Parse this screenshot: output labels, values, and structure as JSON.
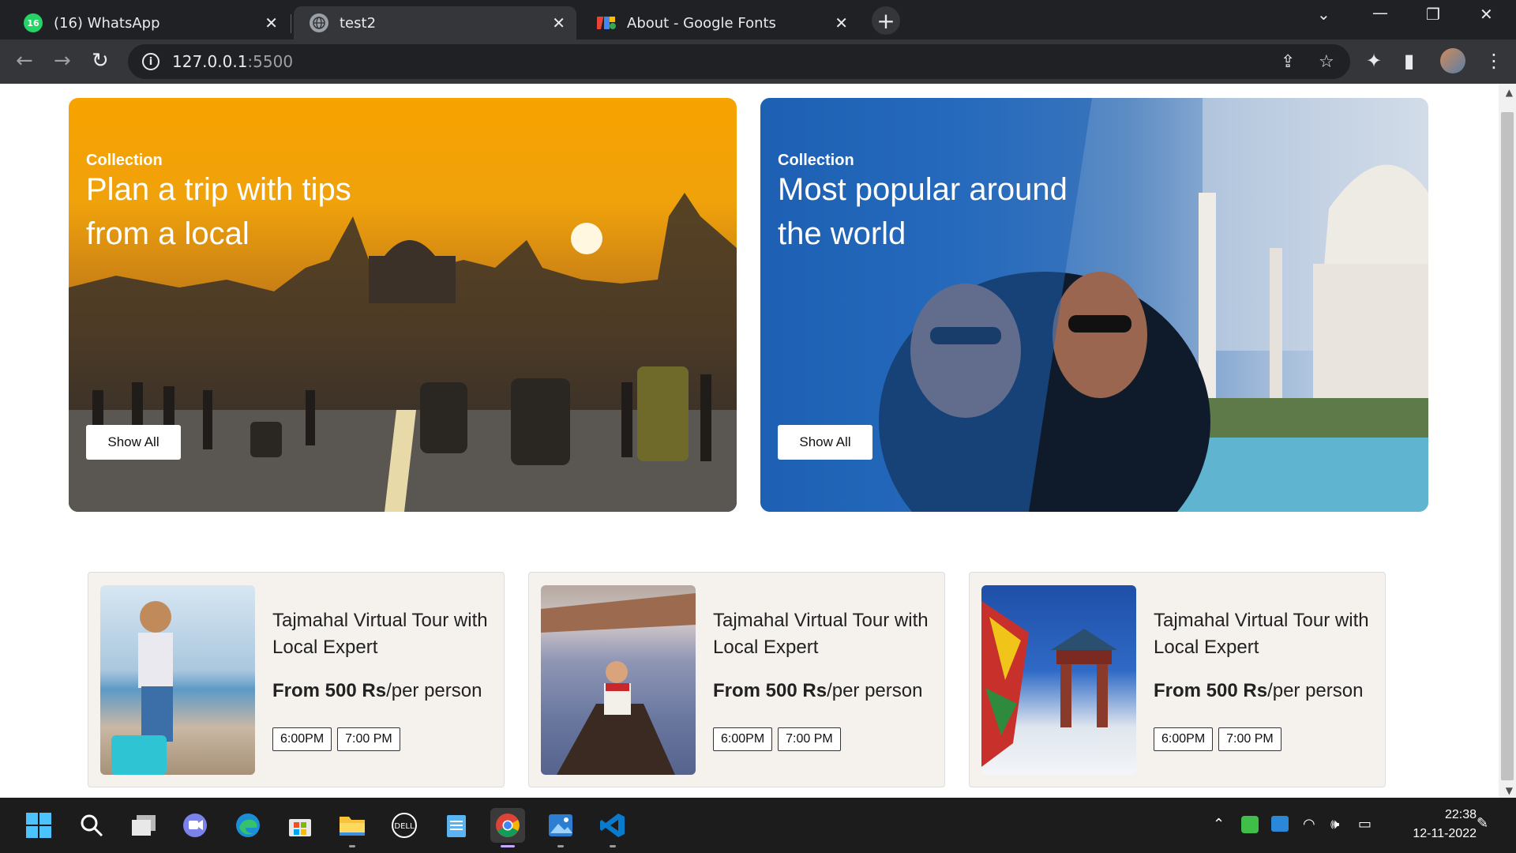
{
  "browser": {
    "tabs": [
      {
        "title": "(16) WhatsApp",
        "badge": "16",
        "favicon": "whatsapp-icon",
        "active": false
      },
      {
        "title": "test2",
        "favicon": "globe-icon",
        "active": true
      },
      {
        "title": "About - Google Fonts",
        "favicon": "google-fonts-icon",
        "active": false
      }
    ],
    "address": {
      "host": "127.0.0.1",
      "port": ":5500"
    }
  },
  "hero_cards": [
    {
      "kicker": "Collection",
      "headline": "Plan a trip with tips from a local",
      "button": "Show All"
    },
    {
      "kicker": "Collection",
      "headline": "Most popular around the world",
      "button": "Show All"
    }
  ],
  "tours": [
    {
      "title": "Tajmahal Virtual Tour with Local Expert",
      "price_bold": "From 500 Rs",
      "price_unit": "/per person",
      "slots": [
        "6:00PM",
        "7:00 PM"
      ]
    },
    {
      "title": "Tajmahal Virtual Tour with Local Expert",
      "price_bold": "From 500 Rs",
      "price_unit": "/per person",
      "slots": [
        "6:00PM",
        "7:00 PM"
      ]
    },
    {
      "title": "Tajmahal Virtual Tour with Local Expert",
      "price_bold": "From 500 Rs",
      "price_unit": "/per person",
      "slots": [
        "6:00PM",
        "7:00 PM"
      ]
    }
  ],
  "taskbar": {
    "time": "22:38",
    "date": "12-11-2022",
    "apps": [
      "start-icon",
      "search-icon",
      "task-view-icon",
      "teams-chat-icon",
      "edge-icon",
      "store-icon",
      "file-explorer-icon",
      "dell-icon",
      "notepad-icon",
      "chrome-icon",
      "photos-icon",
      "vscode-icon"
    ]
  },
  "colors": {
    "chrome_dark": "#202124",
    "chrome_toolbar": "#35363a",
    "card_bg": "#f5f2ee",
    "taskbar": "#1c1c1c"
  }
}
